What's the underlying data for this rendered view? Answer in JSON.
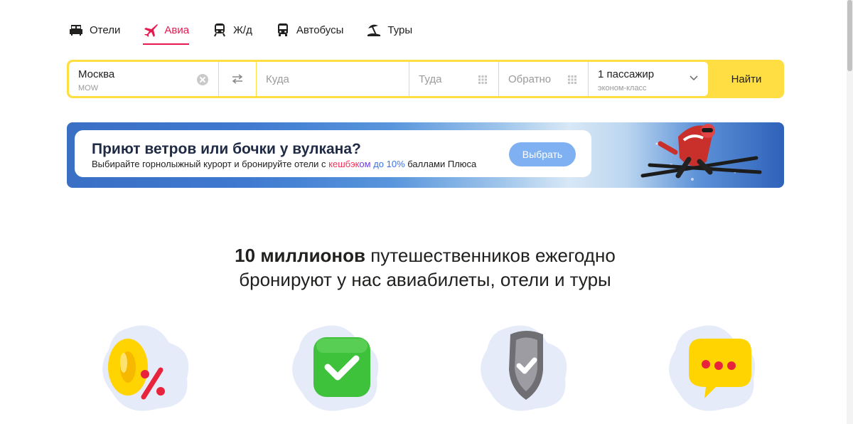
{
  "nav": {
    "tabs": [
      {
        "label": "Отели",
        "icon": "bed-icon",
        "active": false
      },
      {
        "label": "Авиа",
        "icon": "plane-icon",
        "active": true
      },
      {
        "label": "Ж/д",
        "icon": "train-icon",
        "active": false
      },
      {
        "label": "Автобусы",
        "icon": "bus-icon",
        "active": false
      },
      {
        "label": "Туры",
        "icon": "beach-umbrella-icon",
        "active": false
      }
    ],
    "accent": "#e8194f"
  },
  "search": {
    "from": {
      "value": "Москва",
      "code": "MOW"
    },
    "to": {
      "placeholder": "Куда"
    },
    "departure": {
      "placeholder": "Туда"
    },
    "return": {
      "placeholder": "Обратно"
    },
    "passengers": {
      "value": "1 пассажир",
      "class": "эконом-класс"
    },
    "find_label": "Найти",
    "accent": "#ffde43"
  },
  "banner": {
    "title": "Приют ветров или бочки у вулкана?",
    "text_before": "Выбирайте горнолыжный курорт и бронируйте отели с ",
    "cashback_1": "кешбэк",
    "cashback_2": "ом ",
    "cashback_3": "до 10%",
    "text_after": " баллами Плюса",
    "button_label": "Выбрать"
  },
  "headline": {
    "bold": "10 миллионов",
    "line1_rest": " путешественников ежегодно",
    "line2": "бронируют у нас авиабилеты, отели и туры"
  },
  "features": [
    {
      "icon": "zero-percent-icon"
    },
    {
      "icon": "green-check-icon"
    },
    {
      "icon": "shield-check-icon"
    },
    {
      "icon": "chat-bubble-icon"
    }
  ]
}
